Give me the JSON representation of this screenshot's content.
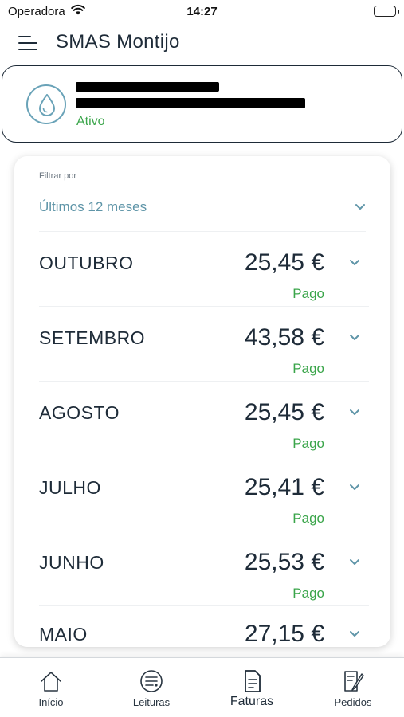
{
  "status_bar": {
    "carrier": "Operadora",
    "time": "14:27"
  },
  "header": {
    "title": "SMAS Montijo",
    "menu_icon": "hamburger-menu-icon"
  },
  "account": {
    "status": "Ativo",
    "icon": "water-drop-icon"
  },
  "filter": {
    "label": "Filtrar por",
    "value": "Últimos 12 meses"
  },
  "invoices": [
    {
      "month": "OUTUBRO",
      "amount": "25,45 €",
      "status": "Pago"
    },
    {
      "month": "SETEMBRO",
      "amount": "43,58 €",
      "status": "Pago"
    },
    {
      "month": "AGOSTO",
      "amount": "25,45 €",
      "status": "Pago"
    },
    {
      "month": "JULHO",
      "amount": "25,41 €",
      "status": "Pago"
    },
    {
      "month": "JUNHO",
      "amount": "25,53 €",
      "status": "Pago"
    }
  ],
  "partial_invoice": {
    "month": "MAIO",
    "amount": "27,15 €"
  },
  "tabs": [
    {
      "label": "Início",
      "icon": "home-icon"
    },
    {
      "label": "Leituras",
      "icon": "meter-icon"
    },
    {
      "label": "Faturas",
      "icon": "invoice-icon",
      "active": true
    },
    {
      "label": "Pedidos",
      "icon": "request-icon"
    }
  ],
  "colors": {
    "accent": "#5f95a8",
    "paid": "#3aa54a",
    "text": "#1e2b38"
  }
}
